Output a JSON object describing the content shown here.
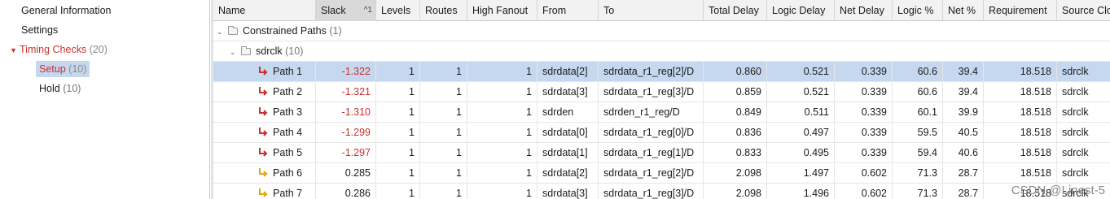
{
  "nav": {
    "general_information": "General Information",
    "settings": "Settings",
    "timing_checks": {
      "label": "Timing Checks",
      "count": "(20)"
    },
    "setup": {
      "label": "Setup",
      "count": "(10)"
    },
    "hold": {
      "label": "Hold",
      "count": "(10)"
    }
  },
  "table": {
    "columns": {
      "name": "Name",
      "slack": "Slack",
      "slack_sort": "^1",
      "levels": "Levels",
      "routes": "Routes",
      "high_fanout": "High Fanout",
      "from": "From",
      "to": "To",
      "total_delay": "Total Delay",
      "logic_delay": "Logic Delay",
      "net_delay": "Net Delay",
      "logic_pct": "Logic %",
      "net_pct": "Net %",
      "requirement": "Requirement",
      "source_clock": "Source Clo"
    },
    "group": {
      "label": "Constrained Paths",
      "count": "(1)"
    },
    "subgroup": {
      "label": "sdrclk",
      "count": "(10)"
    },
    "rows": [
      {
        "name": "Path 1",
        "slack": "-1.322",
        "levels": "1",
        "routes": "1",
        "high_fanout": "1",
        "from": "sdrdata[2]",
        "to": "sdrdata_r1_reg[2]/D",
        "total_delay": "0.860",
        "logic_delay": "0.521",
        "net_delay": "0.339",
        "logic_pct": "60.6",
        "net_pct": "39.4",
        "requirement": "18.518",
        "source_clock": "sdrclk"
      },
      {
        "name": "Path 2",
        "slack": "-1.321",
        "levels": "1",
        "routes": "1",
        "high_fanout": "1",
        "from": "sdrdata[3]",
        "to": "sdrdata_r1_reg[3]/D",
        "total_delay": "0.859",
        "logic_delay": "0.521",
        "net_delay": "0.339",
        "logic_pct": "60.6",
        "net_pct": "39.4",
        "requirement": "18.518",
        "source_clock": "sdrclk"
      },
      {
        "name": "Path 3",
        "slack": "-1.310",
        "levels": "1",
        "routes": "1",
        "high_fanout": "1",
        "from": "sdrden",
        "to": "sdrden_r1_reg/D",
        "total_delay": "0.849",
        "logic_delay": "0.511",
        "net_delay": "0.339",
        "logic_pct": "60.1",
        "net_pct": "39.9",
        "requirement": "18.518",
        "source_clock": "sdrclk"
      },
      {
        "name": "Path 4",
        "slack": "-1.299",
        "levels": "1",
        "routes": "1",
        "high_fanout": "1",
        "from": "sdrdata[0]",
        "to": "sdrdata_r1_reg[0]/D",
        "total_delay": "0.836",
        "logic_delay": "0.497",
        "net_delay": "0.339",
        "logic_pct": "59.5",
        "net_pct": "40.5",
        "requirement": "18.518",
        "source_clock": "sdrclk"
      },
      {
        "name": "Path 5",
        "slack": "-1.297",
        "levels": "1",
        "routes": "1",
        "high_fanout": "1",
        "from": "sdrdata[1]",
        "to": "sdrdata_r1_reg[1]/D",
        "total_delay": "0.833",
        "logic_delay": "0.495",
        "net_delay": "0.339",
        "logic_pct": "59.4",
        "net_pct": "40.6",
        "requirement": "18.518",
        "source_clock": "sdrclk"
      },
      {
        "name": "Path 6",
        "slack": "0.285",
        "levels": "1",
        "routes": "1",
        "high_fanout": "1",
        "from": "sdrdata[2]",
        "to": "sdrdata_r1_reg[2]/D",
        "total_delay": "2.098",
        "logic_delay": "1.497",
        "net_delay": "0.602",
        "logic_pct": "71.3",
        "net_pct": "28.7",
        "requirement": "18.518",
        "source_clock": "sdrclk"
      },
      {
        "name": "Path 7",
        "slack": "0.286",
        "levels": "1",
        "routes": "1",
        "high_fanout": "1",
        "from": "sdrdata[3]",
        "to": "sdrdata_r1_reg[3]/D",
        "total_delay": "2.098",
        "logic_delay": "1.496",
        "net_delay": "0.602",
        "logic_pct": "71.3",
        "net_pct": "28.7",
        "requirement": "18.518",
        "source_clock": "sdrclk"
      }
    ]
  },
  "watermark": "CSDN @Linest-5",
  "colors": {
    "negative_slack": "#c9302c",
    "selection": "#c6d8ef",
    "failing_path_icon": "#c9302c",
    "passing_path_icon": "#e0a800"
  },
  "icons": {
    "failing_path": "red-path-icon",
    "passing_path": "yellow-path-icon",
    "folder": "folder-icon",
    "expand": "chevron-down-icon"
  }
}
